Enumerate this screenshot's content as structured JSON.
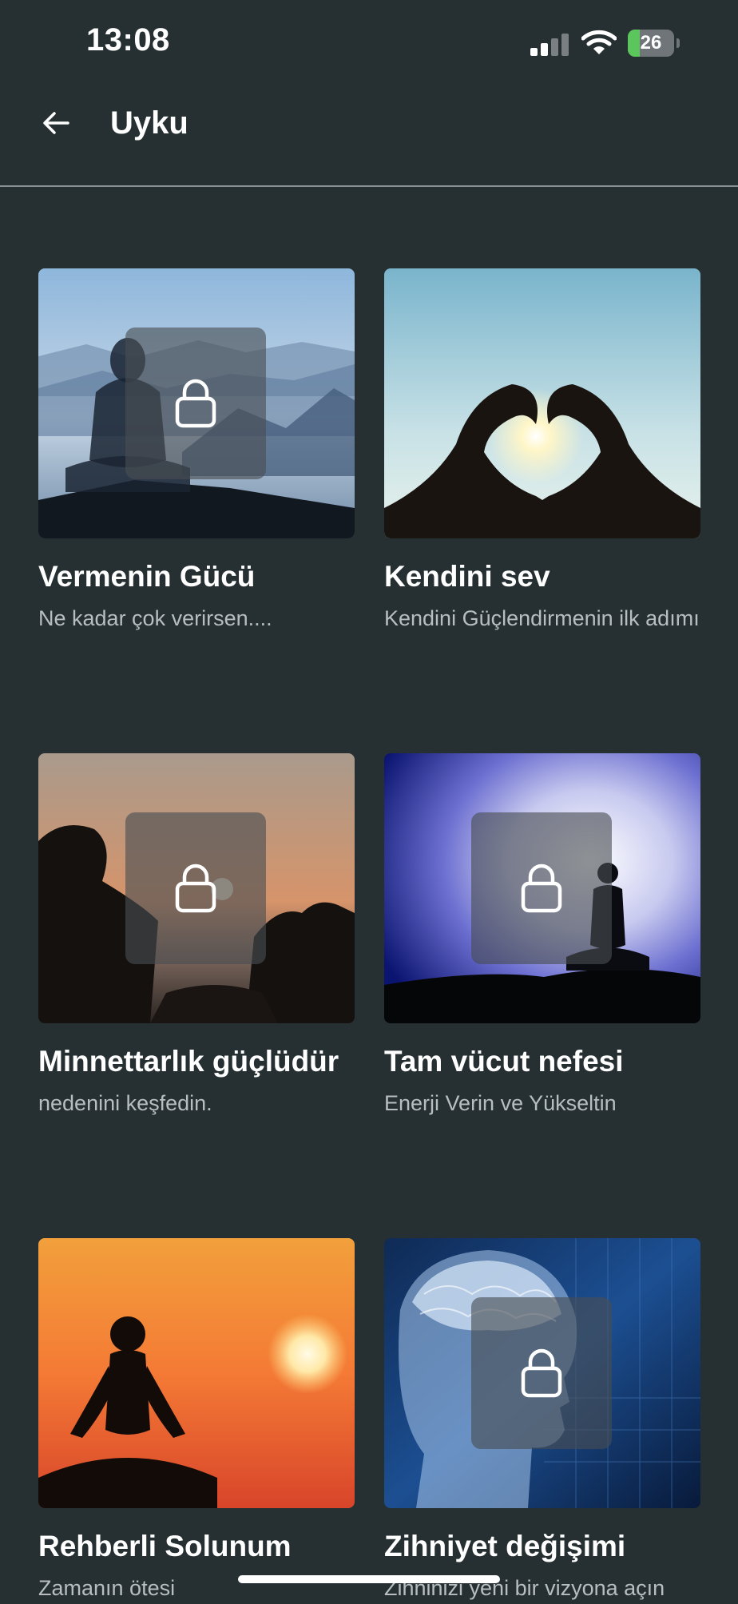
{
  "status": {
    "time": "13:08",
    "battery": "26"
  },
  "header": {
    "title": "Uyku"
  },
  "cards": [
    {
      "title": "Vermenin Gücü",
      "subtitle": "Ne kadar çok verirsen....",
      "icon": "lock-icon",
      "locked": true
    },
    {
      "title": "Kendini sev",
      "subtitle": "Kendini Güçlendirmenin ilk adımı",
      "locked": false
    },
    {
      "title": "Minnettarlık güçlüdür",
      "subtitle": "nedenini keşfedin.",
      "icon": "lock-icon",
      "locked": true
    },
    {
      "title": "Tam vücut nefesi",
      "subtitle": "Enerji Verin ve Yükseltin",
      "icon": "lock-icon",
      "locked": true
    },
    {
      "title": "Rehberli Solunum",
      "subtitle": "Zamanın ötesi",
      "locked": false
    },
    {
      "title": "Zihniyet değişimi",
      "subtitle": "Zihninizi yeni bir vizyona açın",
      "icon": "lock-icon",
      "locked": true
    }
  ],
  "colors": {
    "background": "#263032",
    "subtitle": "#b8bec0",
    "battery_fill": "#5ac65c"
  }
}
